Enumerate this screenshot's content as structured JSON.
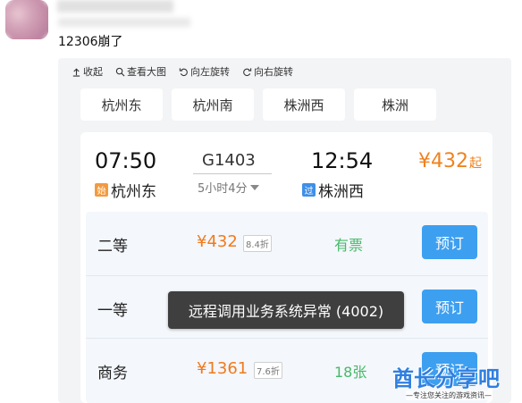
{
  "post": {
    "text": "12306崩了"
  },
  "toolbar": [
    {
      "label": "收起",
      "icon": "collapse-icon"
    },
    {
      "label": "查看大图",
      "icon": "magnify-icon"
    },
    {
      "label": "向左旋转",
      "icon": "rotate-left-icon"
    },
    {
      "label": "向右旋转",
      "icon": "rotate-right-icon"
    }
  ],
  "stations": [
    "杭州东",
    "杭州南",
    "株洲西",
    "株洲"
  ],
  "train": {
    "depart_time": "07:50",
    "arrive_time": "12:54",
    "number": "G1403",
    "duration": "5小时4分",
    "depart_station": "杭州东",
    "arrive_station": "株洲西",
    "depart_tag": "始",
    "arrive_tag": "过",
    "price_from": "¥432",
    "price_from_unit": "起"
  },
  "seats": [
    {
      "class": "二等",
      "price": "¥432",
      "discount": "8.4折",
      "availability": "有票",
      "button": "预订"
    },
    {
      "class": "一等",
      "price": "",
      "discount": "",
      "availability": "",
      "button": "预订"
    },
    {
      "class": "商务",
      "price": "¥1361",
      "discount": "7.6折",
      "availability": "18张",
      "button": "预订"
    }
  ],
  "toast": "远程调用业务系统异常 (4002)",
  "watermark": {
    "title": "酋长分享吧",
    "subtitle": "—专注您关注的游戏资讯—"
  },
  "colors": {
    "price": "#f07a1e",
    "available": "#47b96a",
    "button": "#3d9ff0",
    "toast_bg": "#3f3f3f"
  }
}
